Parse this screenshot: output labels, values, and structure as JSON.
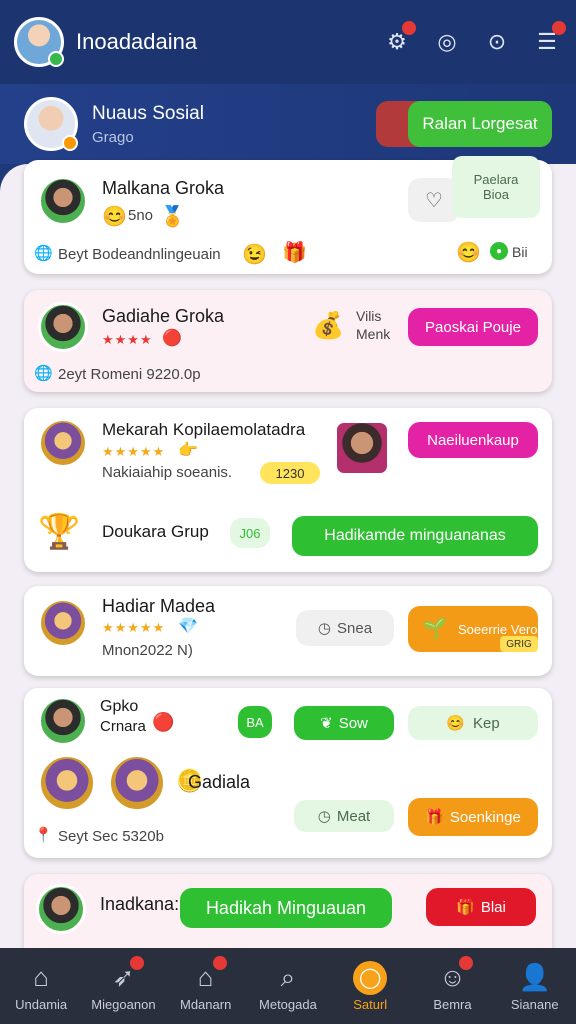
{
  "topbar": {
    "title": "Inoadadaina",
    "icons": [
      "profile-switch-icon",
      "bell-icon",
      "coin-icon",
      "menu-icon"
    ]
  },
  "profile": {
    "name": "Nuaus Sosial",
    "sub": "Grago",
    "leader_button": "Ralan Lorgesat"
  },
  "cards": [
    {
      "title": "Malkana Groka",
      "level": "5no",
      "meta": "Beyt Bodeandnlingeuain",
      "right_top": "Paelara",
      "right_sub": "Bioa",
      "right_bottom": "Bii"
    },
    {
      "title": "Gadiahe Groka",
      "meta": "2eyt Romeni 9220.0p",
      "label_top": "Vilis",
      "label_bottom": "Menk",
      "button": "Paoskai Pouje"
    },
    {
      "title": "Mekarah Kopilaemolatadra",
      "meta": "Nakiaiahip soeanis.",
      "counter": "1230",
      "button_top": "Naeiluenkaup",
      "title2": "Doukara Grup",
      "tag": "J06",
      "button_main": "Hadikamde minguananas"
    },
    {
      "title": "Hadiar Madea",
      "meta": "Mnon2022 N)",
      "chip": "Snea",
      "button": "Soeerrie Vero",
      "button_badge": "GRIG"
    },
    {
      "title": "Gpko",
      "subtitle": "Crnara",
      "tag": "BA",
      "pill_save": "Sow",
      "pill_kep": "Kep",
      "title2": "Gadiala",
      "pill_meat": "Meat",
      "button": "Soenkinge",
      "meta": "Seyt Sec 5320b"
    },
    {
      "title": "Inadkana:",
      "button_main": "Hadikah Minguauan",
      "button_red": "Blai"
    }
  ],
  "bottom_nav": [
    {
      "label": "Undamia",
      "icon": "home-icon"
    },
    {
      "label": "Miegoanon",
      "icon": "compass-icon"
    },
    {
      "label": "Mdanarn",
      "icon": "house-icon"
    },
    {
      "label": "Metogada",
      "icon": "search-icon"
    },
    {
      "label": "Saturl",
      "icon": "circle-icon"
    },
    {
      "label": "Bemra",
      "icon": "smile-icon"
    },
    {
      "label": "Sianane",
      "icon": "person-icon"
    }
  ],
  "colors": {
    "primary_bg": "#1c3470",
    "green": "#2fbf33",
    "pink": "#e322a6",
    "orange": "#f39a17",
    "red": "#e0182a"
  }
}
